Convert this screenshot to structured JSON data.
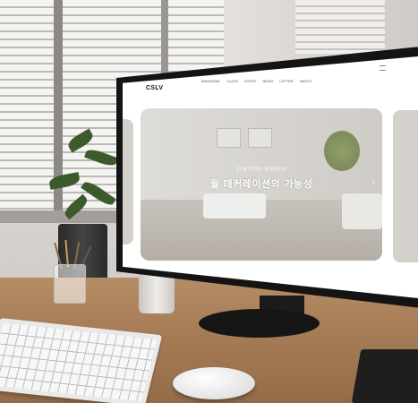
{
  "website": {
    "logo": "CSLV",
    "logo_sub": "",
    "menu": [
      "MAGAZINE",
      "CLASS",
      "EVENT",
      "NEWS",
      "LETTER",
      "ABOUT"
    ],
    "hero_subtitle": "공간을 완성하는 월데코레이션",
    "hero_title": "월 데커레이션의 가능성"
  },
  "icons": {
    "menu": "hamburger-icon",
    "next": "chevron-right-icon"
  }
}
